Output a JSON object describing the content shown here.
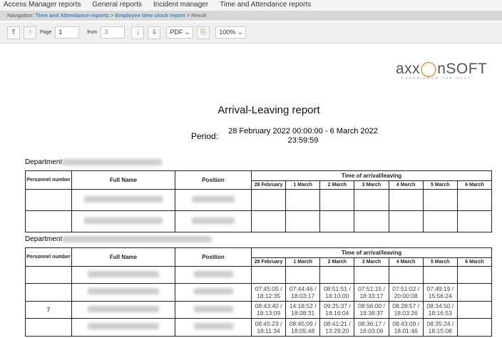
{
  "menu": [
    "Access Manager reports",
    "General reports",
    "Incident manager",
    "Time and Attendance reports"
  ],
  "breadcrumb": {
    "label": "Navigation:",
    "items": [
      "Time and Attendance reports",
      "Employee time clock report"
    ],
    "current": "Result",
    "sep": ">"
  },
  "toolbar": {
    "page_label": "Page",
    "page": "1",
    "from_label": "from",
    "total": "3",
    "format": "PDF",
    "zoom": "100%"
  },
  "logo": {
    "text": "axxonsoft",
    "tagline": "EXPERIENCE THE NEXT"
  },
  "report": {
    "title": "Arrival-Leaving report",
    "period_label": "Period:",
    "period": "28 February 2022 00:00:00 - 6 March 2022 23:59:59",
    "department_label": "Department",
    "headers": {
      "personnel": "Personnel number",
      "full_name": "Full Name",
      "position": "Position",
      "time": "Time of arrival/leaving"
    },
    "days": [
      "28 February",
      "1 March",
      "2 March",
      "3 March",
      "4 March",
      "5 March",
      "6 March"
    ],
    "table2_rows": [
      {
        "num": "",
        "times": [
          "",
          "",
          "",
          "",
          "",
          "",
          ""
        ]
      },
      {
        "num": "",
        "times": [
          "07:45:05 / 18:12:35",
          "07:44:46 / 18:03:17",
          "08:51:51 / 18:10:00",
          "07:51:15 / 18:33:17",
          "07:51:02 / 20:00:08",
          "07:49:19 / 15:56:24",
          ""
        ]
      },
      {
        "num": "7",
        "times": [
          "08:43:40 / 18:13:09",
          "14:18:52 / 18:08:31",
          "09:25:37 / 18:16:04",
          "08:56:00 / 19:38:37",
          "08:28:57 / 18:03:26",
          "08:34:50 / 18:16:53",
          ""
        ]
      },
      {
        "num": "",
        "times": [
          "08:45:23 / 18:11:34",
          "08:45:09 / 18:05:48",
          "08:41:21 / 13:29:20",
          "08:36:17 / 16:03:09",
          "08:43:09 / 18:01:46",
          "08:35:24 / 18:15:08",
          ""
        ]
      }
    ]
  }
}
